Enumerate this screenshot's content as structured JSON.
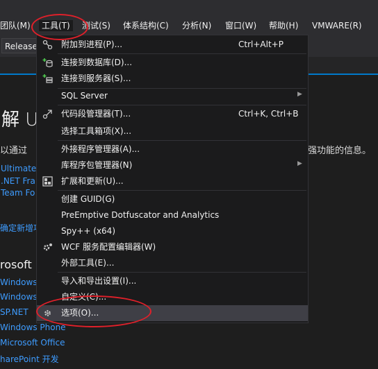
{
  "menubar": {
    "items": [
      {
        "label": "团队(M)"
      },
      {
        "label": "工具(T)"
      },
      {
        "label": "测试(S)"
      },
      {
        "label": "体系结构(C)"
      },
      {
        "label": "分析(N)"
      },
      {
        "label": "窗口(W)"
      },
      {
        "label": "帮助(H)"
      },
      {
        "label": "VMWARE(R)"
      }
    ]
  },
  "toolbar": {
    "config_value": "Release"
  },
  "startpage": {
    "heading": "解 U",
    "intro_left": "以通过",
    "intro_right": "强功能的信息。",
    "links_a": [
      "Ultimate",
      ".NET Fra",
      "Team Fo"
    ],
    "new_link": "确定新增项",
    "section": "rosoft",
    "links_b": [
      "Windows",
      "Windows",
      "SP.NET",
      "Windows Phone",
      "Microsoft Office",
      "harePoint 开发"
    ]
  },
  "menu": {
    "items": [
      {
        "label": "附加到进程(P)...",
        "shortcut": "Ctrl+Alt+P",
        "icon": "attach-process-icon"
      },
      {
        "label": "连接到数据库(D)...",
        "shortcut": "",
        "icon": "connect-database-icon"
      },
      {
        "label": "连接到服务器(S)...",
        "shortcut": "",
        "icon": "connect-server-icon"
      },
      {
        "label": "SQL Server",
        "shortcut": "",
        "submenu": true
      },
      {
        "label": "代码段管理器(T)...",
        "shortcut": "Ctrl+K, Ctrl+B",
        "icon": "code-snippets-icon"
      },
      {
        "label": "选择工具箱项(X)...",
        "shortcut": ""
      },
      {
        "label": "外接程序管理器(A)...",
        "shortcut": ""
      },
      {
        "label": "库程序包管理器(N)",
        "shortcut": "",
        "submenu": true
      },
      {
        "label": "扩展和更新(U)...",
        "shortcut": "",
        "icon": "extensions-icon"
      },
      {
        "label": "创建 GUID(G)",
        "shortcut": ""
      },
      {
        "label": "PreEmptive Dotfuscator and Analytics",
        "shortcut": ""
      },
      {
        "label": "Spy++ (x64)",
        "shortcut": ""
      },
      {
        "label": "WCF 服务配置编辑器(W)",
        "shortcut": "",
        "icon": "wcf-config-icon"
      },
      {
        "label": "外部工具(E)...",
        "shortcut": ""
      },
      {
        "label": "导入和导出设置(I)...",
        "shortcut": ""
      },
      {
        "label": "自定义(C)...",
        "shortcut": ""
      },
      {
        "label": "选项(O)...",
        "shortcut": "",
        "icon": "gear-icon",
        "highlighted": true
      }
    ]
  },
  "colors": {
    "accent": "#007acc",
    "annotation": "#e0202a",
    "link": "#3e9cff"
  }
}
